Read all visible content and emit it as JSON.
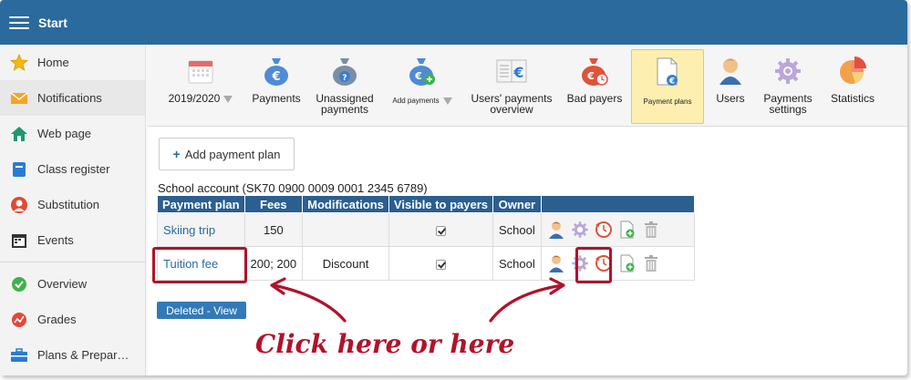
{
  "app": {
    "title": "Start"
  },
  "sidebar": {
    "items": [
      {
        "label": "Home",
        "icon": "star-icon"
      },
      {
        "label": "Notifications",
        "icon": "envelope-icon"
      },
      {
        "label": "Web page",
        "icon": "house-icon"
      },
      {
        "label": "Class register",
        "icon": "book-icon"
      },
      {
        "label": "Substitution",
        "icon": "person-icon"
      },
      {
        "label": "Events",
        "icon": "calendar-icon"
      },
      {
        "label": "Overview",
        "icon": "check-circle-icon"
      },
      {
        "label": "Grades",
        "icon": "grades-icon"
      },
      {
        "label": "Plans & Prepar…",
        "icon": "briefcase-icon"
      }
    ],
    "active_index": 1
  },
  "toolbar": {
    "items": [
      {
        "label": "2019/2020",
        "icon": "calendar-icon",
        "dropdown": true
      },
      {
        "label": "Payments",
        "icon": "money-bag-euro-icon"
      },
      {
        "label": "Unassigned payments",
        "icon": "money-bag-question-icon"
      },
      {
        "label": "Add payments",
        "icon": "money-bag-plus-icon",
        "dropdown": true
      },
      {
        "label": "Users' payments overview",
        "icon": "ledger-euro-icon"
      },
      {
        "label": "Bad payers",
        "icon": "money-bag-clock-icon"
      },
      {
        "label": "Payment plans",
        "icon": "document-euro-icon",
        "selected": true
      },
      {
        "label": "Users",
        "icon": "user-icon"
      },
      {
        "label": "Payments settings",
        "icon": "gear-icon"
      },
      {
        "label": "Statistics",
        "icon": "pie-chart-icon"
      }
    ]
  },
  "content": {
    "add_button_label": "Add payment plan",
    "account_label": "School account (SK70 0900 0009 0001 2345 6789)",
    "table": {
      "headers": [
        "Payment plan",
        "Fees",
        "Modifications",
        "Visible to payers",
        "Owner",
        ""
      ],
      "rows": [
        {
          "plan": "Skiing trip",
          "fees": "150",
          "modifications": "",
          "visible": true,
          "owner": "School"
        },
        {
          "plan": "Tuition fee",
          "fees": "200; 200",
          "modifications": "Discount",
          "visible": true,
          "owner": "School"
        }
      ]
    },
    "deleted_button_label": "Deleted - View"
  },
  "annotation": {
    "text": "Click here or here",
    "color": "#b1132a"
  },
  "colors": {
    "topbar": "#2a6a9d",
    "table_header": "#2a5f8f",
    "selected_tab": "#fcefb0",
    "link": "#2a6a9d"
  }
}
